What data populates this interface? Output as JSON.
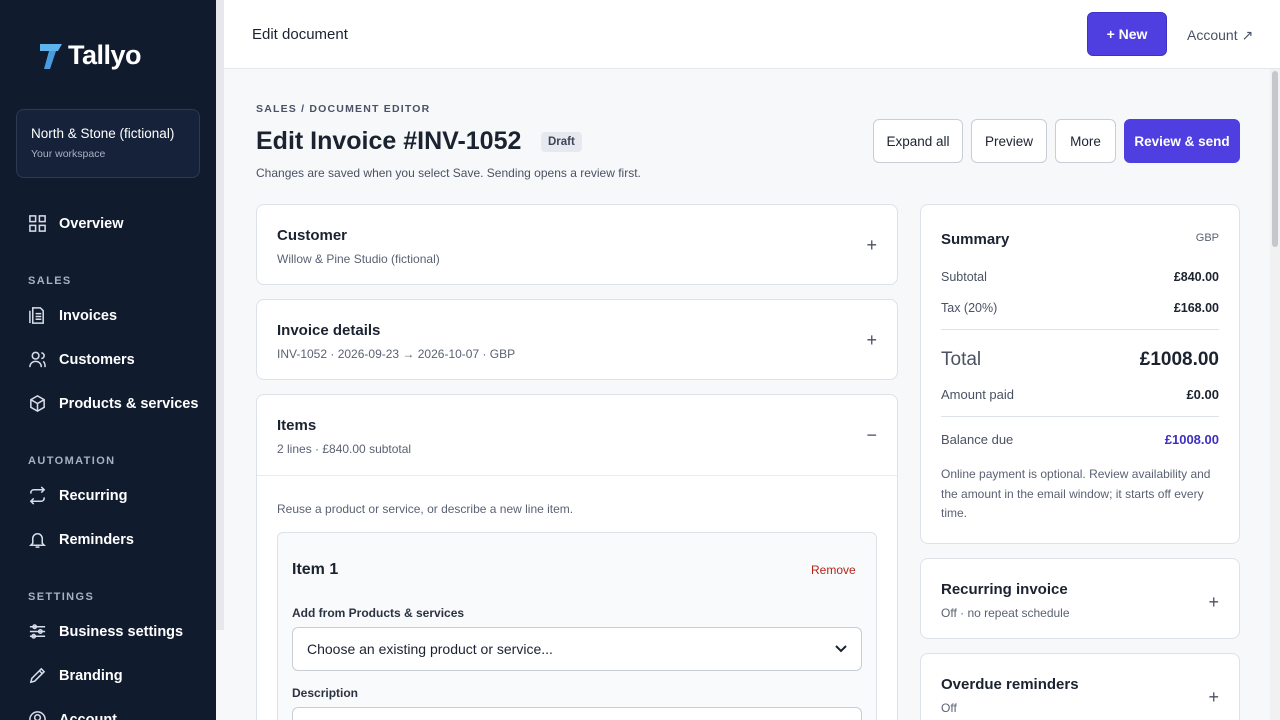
{
  "app": {
    "name": "Tallyo"
  },
  "workspace": {
    "name": "North & Stone (fictional)",
    "sub": "Your workspace"
  },
  "sidebar": {
    "overview": "Overview",
    "sections": {
      "sales": "SALES",
      "automation": "AUTOMATION",
      "settings": "SETTINGS"
    },
    "items": {
      "invoices": "Invoices",
      "customers": "Customers",
      "products": "Products & services",
      "recurring": "Recurring",
      "reminders": "Reminders",
      "business_settings": "Business settings",
      "branding": "Branding",
      "account": "Account"
    }
  },
  "topbar": {
    "title": "Edit document",
    "new_button": "+ New",
    "account_link": "Account ↗"
  },
  "header": {
    "breadcrumb": "SALES / DOCUMENT EDITOR",
    "title": "Edit Invoice #INV-1052",
    "badge": "Draft",
    "subtitle": "Changes are saved when you select Save. Sending opens a review first.",
    "buttons": {
      "expand_all": "Expand all",
      "preview": "Preview",
      "more": "More",
      "review_send": "Review & send"
    }
  },
  "sections": {
    "customer": {
      "title": "Customer",
      "sub": "Willow & Pine Studio (fictional)",
      "toggle": "+"
    },
    "invoice_details": {
      "title": "Invoice details",
      "sub": "INV-1052 · 2026-09-23 → 2026-10-07 · GBP",
      "toggle": "+"
    },
    "items": {
      "title": "Items",
      "sub": "2 lines · £840.00 subtotal",
      "toggle": "−",
      "hint": "Reuse a product or service, or describe a new line item.",
      "item1": {
        "title": "Item 1",
        "remove": "Remove",
        "add_label": "Add from Products & services",
        "select_placeholder": "Choose an existing product or service...",
        "desc_label": "Description"
      }
    }
  },
  "summary": {
    "title": "Summary",
    "currency": "GBP",
    "subtotal_label": "Subtotal",
    "subtotal": "£840.00",
    "tax_label": "Tax (20%)",
    "tax": "£168.00",
    "total_label": "Total",
    "total": "£1008.00",
    "paid_label": "Amount paid",
    "paid": "£0.00",
    "balance_label": "Balance due",
    "balance": "£1008.00",
    "note": "Online payment is optional. Review availability and the amount in the email window; it starts off every time."
  },
  "recurring": {
    "title": "Recurring invoice",
    "sub": "Off · no repeat schedule",
    "toggle": "+"
  },
  "overdue": {
    "title": "Overdue reminders",
    "sub": "Off",
    "toggle": "+"
  },
  "colors": {
    "sidebar": "#111b2e",
    "accent": "#4f3fe0",
    "danger": "#b42318",
    "balance": "#3f2fc0"
  }
}
